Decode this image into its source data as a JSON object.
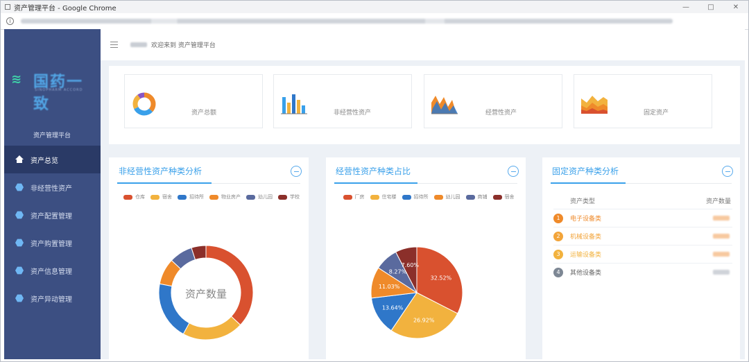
{
  "window": {
    "title": "资产管理平台 - Google Chrome",
    "url": ""
  },
  "colors": {
    "sidebar": "#3c4f82",
    "sidebar_active": "#2a3a66",
    "accent": "#39a0ea",
    "orange": "#ef8a2a",
    "red": "#d9512f",
    "yellow": "#f2b23e",
    "blue": "#2f77c9",
    "slate": "#5a6a9e",
    "maroon": "#8b2f2a",
    "gray_badge": "#7d8794"
  },
  "logo": {
    "icon": "leaf-logo-icon",
    "name": "国药一致",
    "subtitle": "SINOPHARM ACCORD",
    "platform": "资产管理平台"
  },
  "header": {
    "greeting": "欢迎来到 资产管理平台"
  },
  "sidebar": {
    "items": [
      {
        "label": "资产总览",
        "icon": "home-icon",
        "active": true
      },
      {
        "label": "非经营性资产",
        "icon": "hexagon-icon",
        "active": false
      },
      {
        "label": "资产配置管理",
        "icon": "hexagon-icon",
        "active": false
      },
      {
        "label": "资产购置管理",
        "icon": "hexagon-icon",
        "active": false
      },
      {
        "label": "资产信息管理",
        "icon": "hexagon-icon",
        "active": false
      },
      {
        "label": "资产异动管理",
        "icon": "hexagon-icon",
        "active": false
      }
    ]
  },
  "summary": {
    "cards": [
      {
        "value": "",
        "label": "资产总额"
      },
      {
        "value": "",
        "label": "非经营性资产"
      },
      {
        "value": "",
        "label": "经营性资产"
      },
      {
        "value": "",
        "label": "固定资产"
      }
    ]
  },
  "panels": {
    "left": {
      "title": "非经营性资产种类分析",
      "center_label": "资产数量",
      "center_value": "",
      "chart_data": {
        "type": "pie",
        "variant": "donut",
        "legend": [
          "仓库",
          "宿舍",
          "招待所",
          "物业房产",
          "幼儿园",
          "学校"
        ],
        "values": [
          37,
          21,
          20,
          9,
          8,
          5
        ],
        "colors": [
          "#d9512f",
          "#f2b23e",
          "#2f77c9",
          "#ef8a2a",
          "#5a6a9e",
          "#8b2f2a"
        ],
        "legend_position": "top"
      }
    },
    "middle": {
      "title": "经营性资产种类占比",
      "chart_data": {
        "type": "pie",
        "legend": [
          "厂房",
          "住宅楼",
          "招待所",
          "幼儿园",
          "商铺",
          "宿舍"
        ],
        "values": [
          32.52,
          26.92,
          13.64,
          11.03,
          8.27,
          7.6
        ],
        "labels": [
          "32.52%",
          "26.92%",
          "13.64%",
          "11.03%",
          "8.27%",
          "7.60%"
        ],
        "colors": [
          "#d9512f",
          "#f2b23e",
          "#2f77c9",
          "#ef8a2a",
          "#5a6a9e",
          "#8b2f2a"
        ],
        "legend_position": "top"
      }
    },
    "right": {
      "title": "固定资产种类分析",
      "columns": [
        "资产类型",
        "资产数量"
      ],
      "rows": [
        {
          "rank": "1",
          "name": "电子设备类",
          "count": "",
          "color": "#ef8a2a"
        },
        {
          "rank": "2",
          "name": "机械设备类",
          "count": "",
          "color": "#f2a43a"
        },
        {
          "rank": "3",
          "name": "运输设备类",
          "count": "",
          "color": "#f2b23e"
        },
        {
          "rank": "4",
          "name": "其他设备类",
          "count": "",
          "color": "#7d8794"
        }
      ]
    }
  }
}
